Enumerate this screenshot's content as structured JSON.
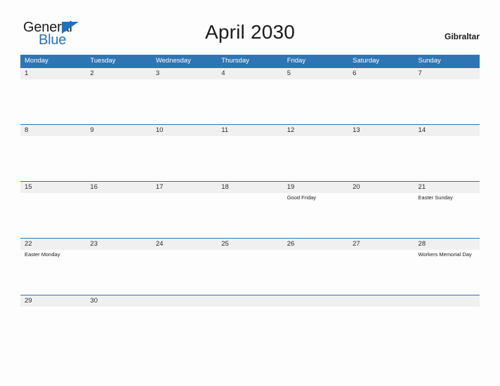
{
  "brand": {
    "name_part1": "General",
    "name_part2": "Blue",
    "triangle_icon": "triangle-icon",
    "accent_color": "#2472b8"
  },
  "header": {
    "title": "April 2030",
    "country": "Gibraltar"
  },
  "theme": {
    "header_blue": "#2e75b6",
    "daynum_band": "#f0f0f0",
    "page_background": "#fdfdfd",
    "text_color": "#1b1b1b"
  },
  "calendar": {
    "month": "April",
    "year": "2030",
    "weekdays": [
      "Monday",
      "Tuesday",
      "Wednesday",
      "Thursday",
      "Friday",
      "Saturday",
      "Sunday"
    ],
    "weeks": [
      {
        "days": [
          {
            "num": "1",
            "events": []
          },
          {
            "num": "2",
            "events": []
          },
          {
            "num": "3",
            "events": []
          },
          {
            "num": "4",
            "events": []
          },
          {
            "num": "5",
            "events": []
          },
          {
            "num": "6",
            "events": []
          },
          {
            "num": "7",
            "events": []
          }
        ]
      },
      {
        "days": [
          {
            "num": "8",
            "events": []
          },
          {
            "num": "9",
            "events": []
          },
          {
            "num": "10",
            "events": []
          },
          {
            "num": "11",
            "events": []
          },
          {
            "num": "12",
            "events": []
          },
          {
            "num": "13",
            "events": []
          },
          {
            "num": "14",
            "events": []
          }
        ]
      },
      {
        "days": [
          {
            "num": "15",
            "events": []
          },
          {
            "num": "16",
            "events": []
          },
          {
            "num": "17",
            "events": []
          },
          {
            "num": "18",
            "events": []
          },
          {
            "num": "19",
            "events": [
              "Good Friday"
            ]
          },
          {
            "num": "20",
            "events": []
          },
          {
            "num": "21",
            "events": [
              "Easter Sunday"
            ]
          }
        ]
      },
      {
        "days": [
          {
            "num": "22",
            "events": [
              "Easter Monday"
            ]
          },
          {
            "num": "23",
            "events": []
          },
          {
            "num": "24",
            "events": []
          },
          {
            "num": "25",
            "events": []
          },
          {
            "num": "26",
            "events": []
          },
          {
            "num": "27",
            "events": []
          },
          {
            "num": "28",
            "events": [
              "Workers Memorial Day"
            ]
          }
        ]
      },
      {
        "days": [
          {
            "num": "29",
            "events": []
          },
          {
            "num": "30",
            "events": []
          },
          {
            "num": "",
            "events": []
          },
          {
            "num": "",
            "events": []
          },
          {
            "num": "",
            "events": []
          },
          {
            "num": "",
            "events": []
          },
          {
            "num": "",
            "events": []
          }
        ]
      }
    ]
  }
}
